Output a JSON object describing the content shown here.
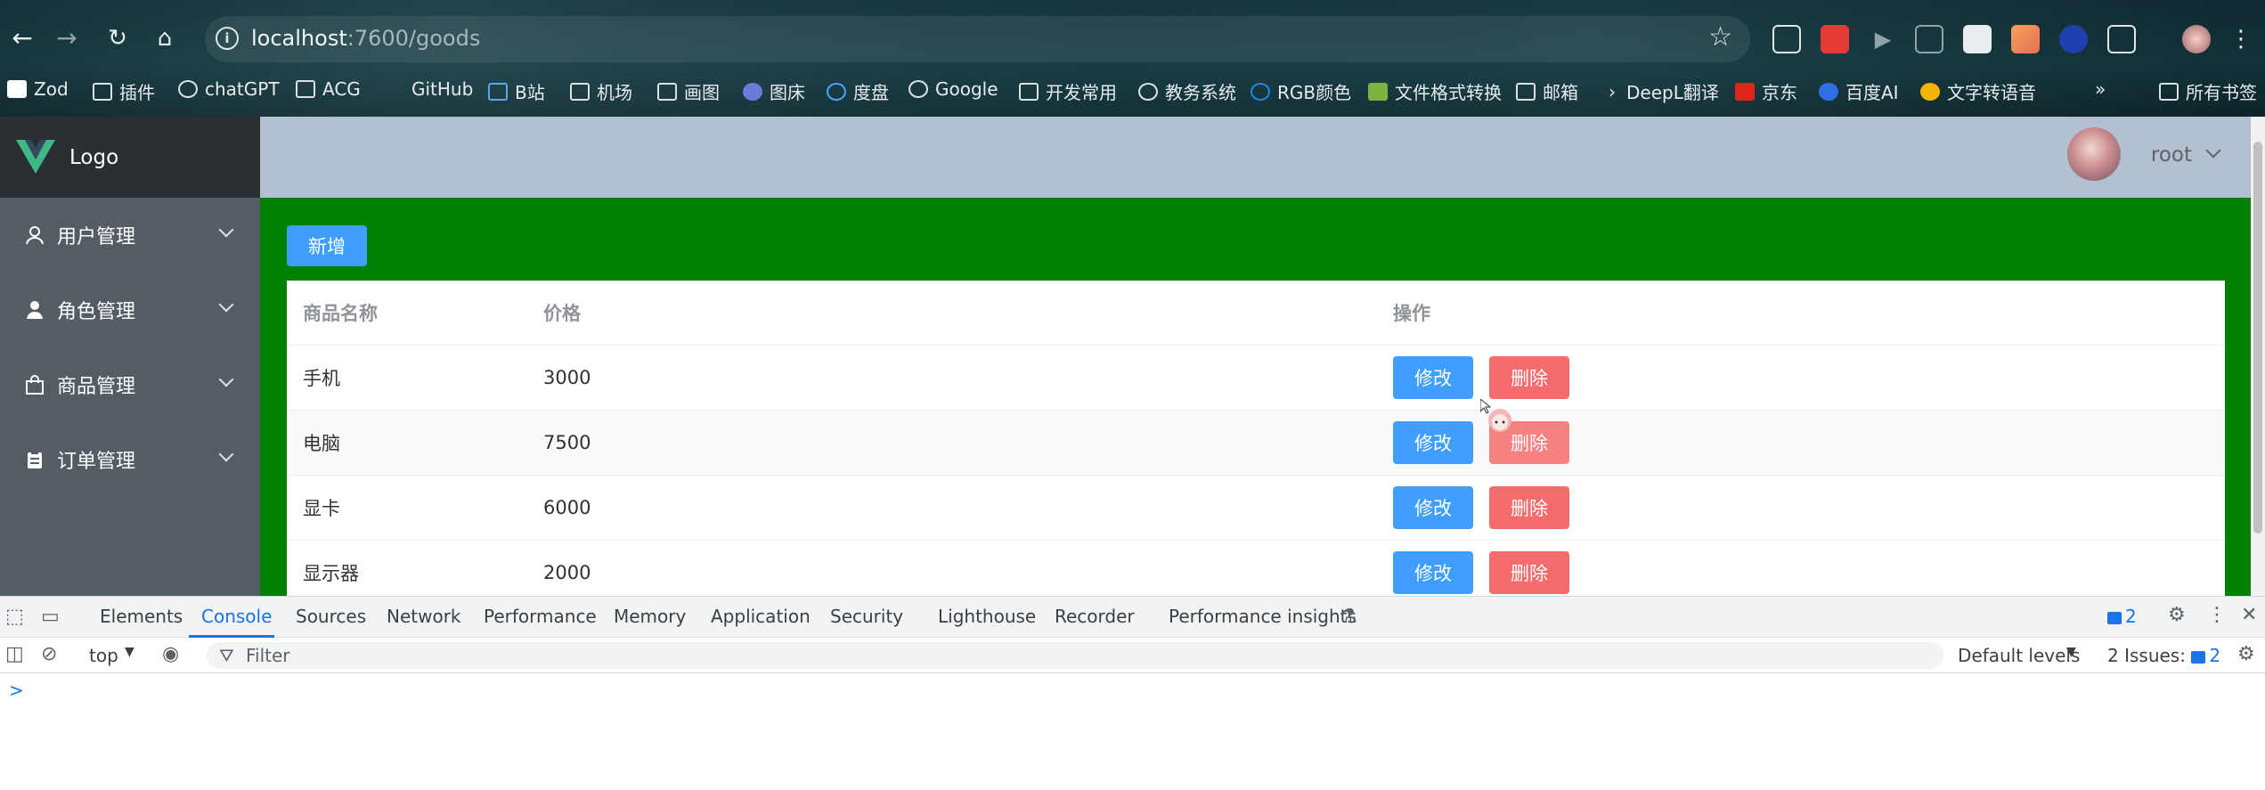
{
  "browser": {
    "url_host": "localhost",
    "url_path": ":7600/goods",
    "bookmarks": [
      "Zod",
      "插件",
      "chatGPT",
      "ACG",
      "GitHub",
      "B站",
      "机场",
      "画图",
      "图床",
      "度盘",
      "Google",
      "开发常用",
      "教务系统",
      "RGB颜色",
      "文件格式转换",
      "邮箱",
      "DeepL翻译",
      "京东",
      "百度AI",
      "文字转语音",
      "所有书签"
    ]
  },
  "sidebar": {
    "logo": "Logo",
    "items": [
      {
        "label": "用户管理",
        "icon": "user-icon"
      },
      {
        "label": "角色管理",
        "icon": "user-filled-icon"
      },
      {
        "label": "商品管理",
        "icon": "shopping-bag-icon"
      },
      {
        "label": "订单管理",
        "icon": "clipboard-icon"
      }
    ]
  },
  "header": {
    "username": "root"
  },
  "main": {
    "add_label": "新增",
    "columns": [
      "商品名称",
      "价格",
      "操作"
    ],
    "rows": [
      {
        "name": "手机",
        "price": "3000"
      },
      {
        "name": "电脑",
        "price": "7500"
      },
      {
        "name": "显卡",
        "price": "6000"
      },
      {
        "name": "显示器",
        "price": "2000"
      }
    ],
    "edit_label": "修改",
    "delete_label": "删除"
  },
  "devtools": {
    "tabs": [
      "Elements",
      "Console",
      "Sources",
      "Network",
      "Performance",
      "Memory",
      "Application",
      "Security",
      "Lighthouse",
      "Recorder",
      "Performance insights"
    ],
    "active_tab": "Console",
    "issue_badge": "2",
    "context": "top",
    "filter_placeholder": "Filter",
    "levels": "Default levels",
    "issues_label": "2 Issues:",
    "issues_count": "2",
    "prompt": ">"
  },
  "colors": {
    "sidebar": "#545c64",
    "header": "#b3c0d1",
    "main": "#008000",
    "primary": "#409eff",
    "danger": "#f56c6c"
  }
}
